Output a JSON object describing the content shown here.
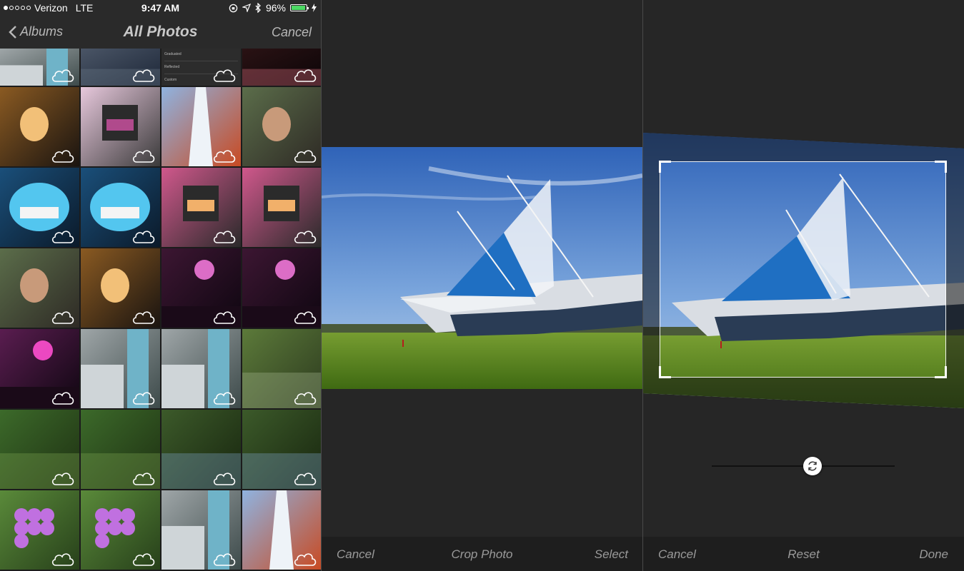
{
  "status_bar": {
    "carrier": "Verizon",
    "network": "LTE",
    "time": "9:47 AM",
    "battery": "96%",
    "battery_level": 0.96
  },
  "picker": {
    "back_label": "Albums",
    "title": "All Photos",
    "cancel_label": "Cancel",
    "thumb_menu_items": [
      "Graduated",
      "Reflected",
      "Custom"
    ]
  },
  "crop_screen": {
    "cancel_label": "Cancel",
    "title": "Crop Photo",
    "select_label": "Select"
  },
  "adjust_screen": {
    "cancel_label": "Cancel",
    "reset_label": "Reset",
    "done_label": "Done"
  },
  "colors": {
    "background": "#262626",
    "toolbar": "#1e1e1e",
    "battery_fill": "#4cd964",
    "toolbar_text": "#9a9a9a"
  }
}
